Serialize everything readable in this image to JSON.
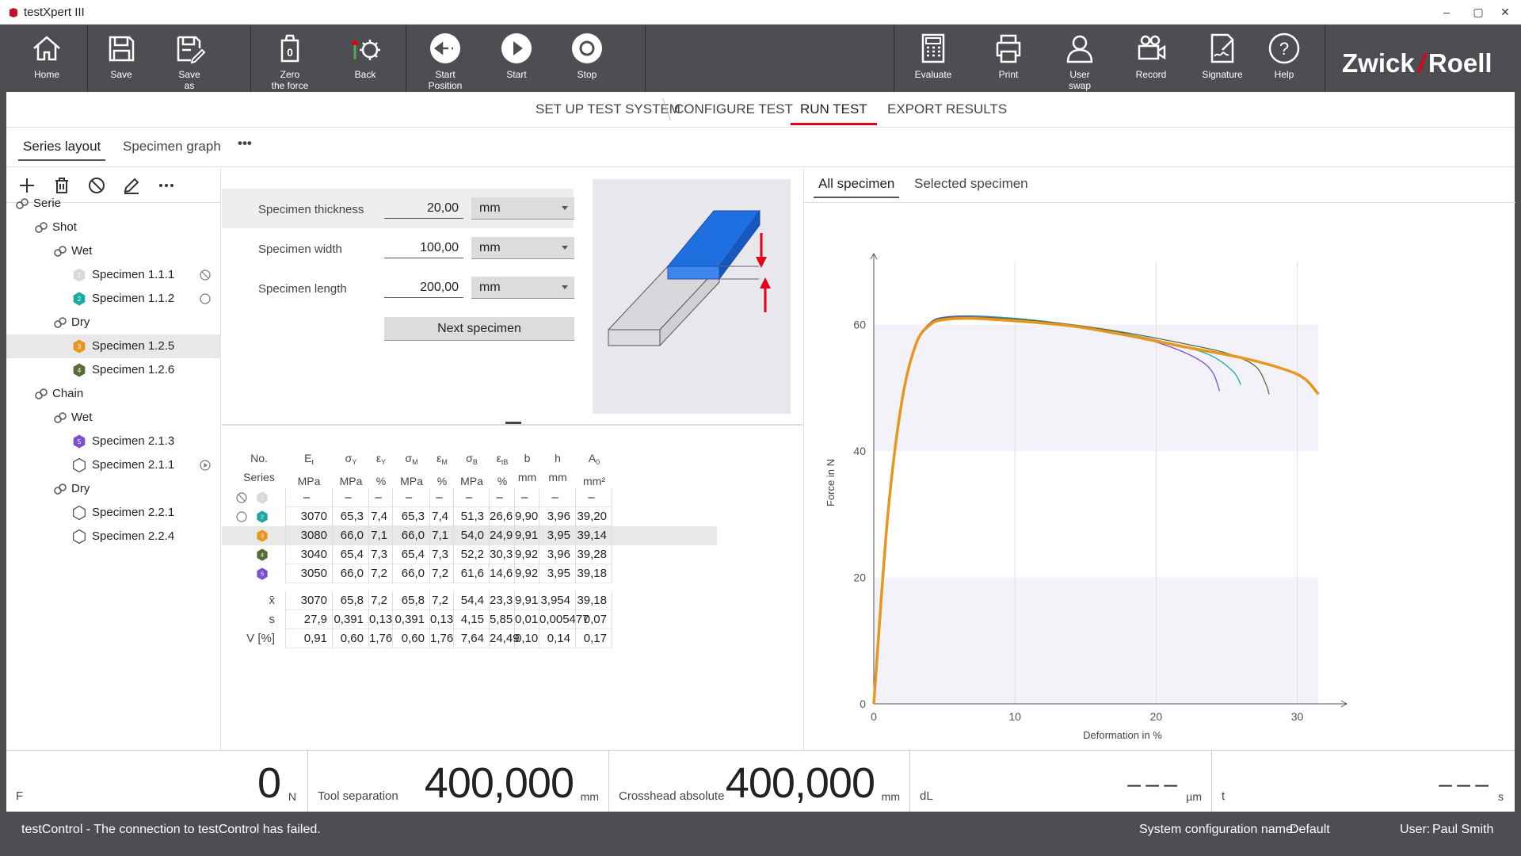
{
  "window": {
    "title": "testXpert III",
    "minimize": "–",
    "maximize": "▢",
    "close": "✕"
  },
  "toolbar": {
    "home": "Home",
    "save": "Save",
    "save_as": "Save\nas",
    "zero_force": "Zero\nthe force",
    "back": "Back",
    "start_position": "Start\nPosition",
    "start": "Start",
    "stop": "Stop",
    "evaluate": "Evaluate",
    "print": "Print",
    "user_swap": "User\nswap",
    "record": "Record",
    "signature": "Signature",
    "help": "Help",
    "logo_left": "Zwick",
    "logo_right": "Roell"
  },
  "wizard": {
    "step1": "SET UP TEST SYSTEM",
    "step2": "CONFIGURE TEST",
    "step3": "RUN TEST",
    "step4": "EXPORT RESULTS"
  },
  "subtabs": {
    "series_layout": "Series layout",
    "specimen_graph": "Specimen graph",
    "more": "•••"
  },
  "tree": {
    "root": "Serie",
    "shot": "Shot",
    "shot_wet": "Wet",
    "s111": "Specimen 1.1.1",
    "s111_badge": "1",
    "s112": "Specimen 1.1.2",
    "s112_badge": "2",
    "shot_dry": "Dry",
    "s125": "Specimen 1.2.5",
    "s125_badge": "3",
    "s126": "Specimen 1.2.6",
    "s126_badge": "4",
    "chain": "Chain",
    "chain_wet": "Wet",
    "s213": "Specimen 2.1.3",
    "s213_badge": "5",
    "s211": "Specimen 2.1.1",
    "chain_dry": "Dry",
    "s221": "Specimen 2.2.1",
    "s224": "Specimen 2.2.4"
  },
  "form": {
    "thickness_label": "Specimen thickness",
    "thickness_value": "20,00",
    "thickness_unit": "mm",
    "width_label": "Specimen width",
    "width_value": "100,00",
    "width_unit": "mm",
    "length_label": "Specimen length",
    "length_value": "200,00",
    "length_unit": "mm",
    "next_button": "Next specimen"
  },
  "table": {
    "headers": [
      {
        "top": "No.",
        "bottom": "Series",
        "sym": "",
        "sub": ""
      },
      {
        "top": "E",
        "sub": "t",
        "bottom": "MPa"
      },
      {
        "top": "σ",
        "sub": "Y",
        "bottom": "MPa"
      },
      {
        "top": "ε",
        "sub": "Y",
        "bottom": "%"
      },
      {
        "top": "σ",
        "sub": "M",
        "bottom": "MPa"
      },
      {
        "top": "ε",
        "sub": "M",
        "bottom": "%"
      },
      {
        "top": "σ",
        "sub": "B",
        "bottom": "MPa"
      },
      {
        "top": "ε",
        "sub": "tB",
        "bottom": "%"
      },
      {
        "top": "b",
        "sub": "",
        "bottom": "mm"
      },
      {
        "top": "h",
        "sub": "",
        "bottom": "mm"
      },
      {
        "top": "A",
        "sub": "0",
        "bottom": "mm²"
      }
    ],
    "rows": [
      {
        "badge": "1",
        "color": "#d8d8d8",
        "cells": [
          "–",
          "–",
          "–",
          "–",
          "–",
          "–",
          "–",
          "–",
          "–",
          "–"
        ]
      },
      {
        "badge": "2",
        "color": "#1aa9a5",
        "cells": [
          "3070",
          "65,3",
          "7,4",
          "65,3",
          "7,4",
          "51,3",
          "26,6",
          "9,90",
          "3,96",
          "39,20"
        ]
      },
      {
        "badge": "3",
        "color": "#e8961e",
        "cells": [
          "3080",
          "66,0",
          "7,1",
          "66,0",
          "7,1",
          "54,0",
          "24,9",
          "9,91",
          "3,95",
          "39,14"
        ]
      },
      {
        "badge": "4",
        "color": "#5a6b3a",
        "cells": [
          "3040",
          "65,4",
          "7,3",
          "65,4",
          "7,3",
          "52,2",
          "30,3",
          "9,92",
          "3,96",
          "39,28"
        ]
      },
      {
        "badge": "5",
        "color": "#7b4fd0",
        "cells": [
          "3050",
          "66,0",
          "7,2",
          "66,0",
          "7,2",
          "61,6",
          "14,6",
          "9,92",
          "3,95",
          "39,18"
        ]
      }
    ],
    "stats": [
      {
        "label": "x̄",
        "cells": [
          "3070",
          "65,8",
          "7,2",
          "65,8",
          "7,2",
          "54,4",
          "23,3",
          "9,91",
          "3,954",
          "39,18"
        ]
      },
      {
        "label": "s",
        "cells": [
          "27,9",
          "0,391",
          "0,13",
          "0,391",
          "0,13",
          "4,15",
          "5,85",
          "0,01",
          "0,005477",
          "0,07"
        ]
      },
      {
        "label": "V [%]",
        "cells": [
          "0,91",
          "0,60",
          "1,76",
          "0,60",
          "1,76",
          "7,64",
          "24,49",
          "0,10",
          "0,14",
          "0,17"
        ]
      }
    ]
  },
  "right_tabs": {
    "all": "All specimen",
    "selected": "Selected specimen"
  },
  "chart_data": {
    "type": "line",
    "xlabel": "Deformation in %",
    "ylabel": "Force in N",
    "xlim": [
      0,
      33
    ],
    "ylim": [
      0,
      70
    ],
    "xticks": [
      0,
      10,
      20,
      30
    ],
    "yticks": [
      0,
      20,
      40,
      60
    ],
    "series": [
      {
        "color": "#7b4fd0",
        "points": [
          [
            0,
            0
          ],
          [
            1,
            30
          ],
          [
            2,
            48
          ],
          [
            3,
            57
          ],
          [
            4,
            60.3
          ],
          [
            5,
            61.2
          ],
          [
            7,
            61.4
          ],
          [
            10,
            61
          ],
          [
            14,
            60
          ],
          [
            18,
            58.5
          ],
          [
            21,
            56.5
          ],
          [
            23,
            54.5
          ],
          [
            24,
            52.5
          ],
          [
            24.5,
            49.5
          ]
        ]
      },
      {
        "color": "#1aa9a5",
        "points": [
          [
            0,
            0
          ],
          [
            1,
            30
          ],
          [
            2,
            48
          ],
          [
            3,
            57
          ],
          [
            4,
            60.3
          ],
          [
            5,
            61.1
          ],
          [
            7,
            61.3
          ],
          [
            10,
            61
          ],
          [
            14,
            60
          ],
          [
            18,
            58.5
          ],
          [
            22,
            56.5
          ],
          [
            24,
            55
          ],
          [
            25.5,
            52.5
          ],
          [
            26,
            50.5
          ]
        ]
      },
      {
        "color": "#5a6b3a",
        "points": [
          [
            0,
            0
          ],
          [
            1,
            30
          ],
          [
            2,
            48
          ],
          [
            3,
            57
          ],
          [
            4,
            60.3
          ],
          [
            5,
            61.1
          ],
          [
            7,
            61.2
          ],
          [
            10,
            60.9
          ],
          [
            14,
            60
          ],
          [
            18,
            58.7
          ],
          [
            22,
            57
          ],
          [
            25,
            55.5
          ],
          [
            27,
            53.5
          ],
          [
            27.8,
            50.5
          ],
          [
            28,
            49
          ]
        ]
      },
      {
        "color": "#e8961e",
        "points": [
          [
            0,
            0
          ],
          [
            1,
            30
          ],
          [
            2,
            48
          ],
          [
            3,
            57
          ],
          [
            4,
            60
          ],
          [
            5,
            60.8
          ],
          [
            7,
            61
          ],
          [
            10,
            60.6
          ],
          [
            14,
            59.8
          ],
          [
            18,
            58.3
          ],
          [
            22,
            56.5
          ],
          [
            26,
            54.8
          ],
          [
            29,
            53
          ],
          [
            30.5,
            51.5
          ],
          [
            31.5,
            49
          ]
        ]
      }
    ]
  },
  "status": {
    "f_label": "F",
    "f_value": "0",
    "f_unit": "N",
    "tool_label": "Tool separation",
    "tool_value": "400,000",
    "tool_unit": "mm",
    "cross_label": "Crosshead absolute",
    "cross_value": "400,000",
    "cross_unit": "mm",
    "dl_label": "dL",
    "dl_value": "– – –",
    "dl_unit": "µm",
    "t_label": "t",
    "t_value": "– – –",
    "t_unit": "s"
  },
  "bottom": {
    "message": "testControl - The connection to testControl has failed.",
    "config_label": "System configuration name:",
    "config_value": "Default",
    "user_label": "User:",
    "user_value": "Paul Smith"
  }
}
